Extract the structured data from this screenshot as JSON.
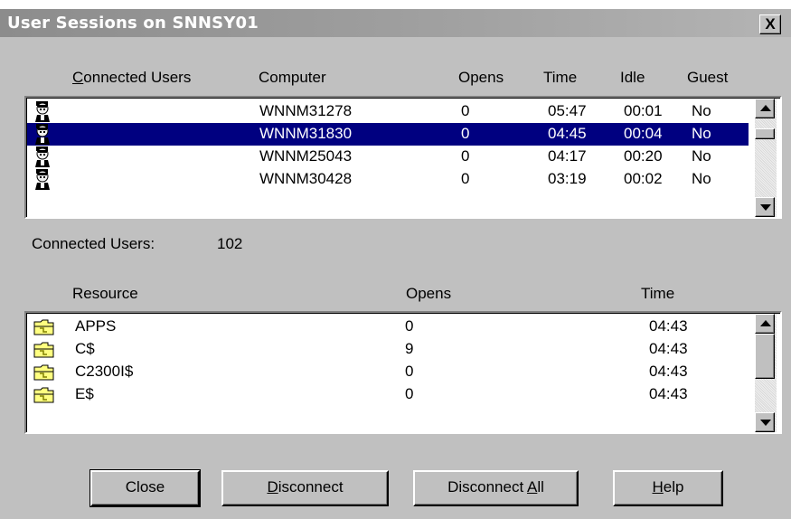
{
  "window": {
    "title": "User Sessions on SNNSY01",
    "close_glyph": "X"
  },
  "users": {
    "headers": [
      "Connected Users",
      "Computer",
      "Opens",
      "Time",
      "Idle",
      "Guest"
    ],
    "rows": [
      {
        "computer": "WNNM31278",
        "opens": "0",
        "time": "05:47",
        "idle": "00:01",
        "guest": "No",
        "selected": false
      },
      {
        "computer": "WNNM31830",
        "opens": "0",
        "time": "04:45",
        "idle": "00:04",
        "guest": "No",
        "selected": true
      },
      {
        "computer": "WNNM25043",
        "opens": "0",
        "time": "04:17",
        "idle": "00:20",
        "guest": "No",
        "selected": false
      },
      {
        "computer": "WNNM30428",
        "opens": "0",
        "time": "03:19",
        "idle": "00:02",
        "guest": "No",
        "selected": false
      }
    ],
    "count_label": "Connected Users:",
    "count_value": "102"
  },
  "resources": {
    "headers": [
      "Resource",
      "Opens",
      "Time"
    ],
    "rows": [
      {
        "name": "APPS",
        "opens": "0",
        "time": "04:43"
      },
      {
        "name": "C$",
        "opens": "9",
        "time": "04:43"
      },
      {
        "name": "C2300I$",
        "opens": "0",
        "time": "04:43"
      },
      {
        "name": "E$",
        "opens": "0",
        "time": "04:43"
      }
    ]
  },
  "buttons": {
    "close": "Close",
    "disconnect": "Disconnect",
    "disconnect_all": "Disconnect All",
    "help": "Help"
  },
  "colors": {
    "selection": "#000080",
    "face": "#c0c0c0"
  }
}
